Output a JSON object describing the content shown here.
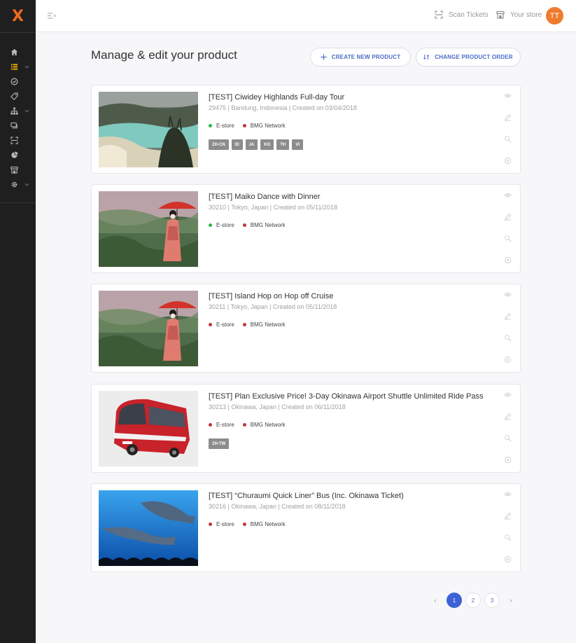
{
  "app": {
    "logo_text": "X",
    "brand_color": "#f26a21",
    "accent_color": "#3d62d6"
  },
  "sidebar": {
    "items": [
      {
        "icon": "home-icon"
      },
      {
        "icon": "list-icon",
        "active": true,
        "has_caret": true
      },
      {
        "icon": "check-circle-icon"
      },
      {
        "icon": "tag-icon"
      },
      {
        "icon": "sitemap-icon",
        "has_caret": true
      },
      {
        "icon": "chat-icon"
      },
      {
        "icon": "scan-icon"
      },
      {
        "icon": "pie-chart-icon"
      },
      {
        "icon": "store-icon"
      },
      {
        "icon": "gear-icon",
        "has_caret": true
      }
    ]
  },
  "topbar": {
    "scan_label": "Scan Tickets",
    "store_label": "Your store",
    "avatar_initials": "TT"
  },
  "page": {
    "title": "Manage & edit your product",
    "create_button": "CREATE NEW PRODUCT",
    "order_button": "CHANGE PRODUCT ORDER"
  },
  "products": [
    {
      "title": "[TEST] Ciwidey Highlands Full-day Tour",
      "meta": "29475 | Bandung, Indonesia | Created on 03/04/2018",
      "channels": [
        {
          "label": "E-store",
          "status_color": "#2db84d"
        },
        {
          "label": "BMG Network",
          "status_color": "#c0363a"
        }
      ],
      "languages": [
        "ZH-CN",
        "ID",
        "JA",
        "KO",
        "TH",
        "VI"
      ],
      "image": "crater-lake-image"
    },
    {
      "title": "[TEST] Maiko Dance with Dinner",
      "meta": "30210 | Tokyo, Japan | Created on 05/11/2018",
      "channels": [
        {
          "label": "E-store",
          "status_color": "#2db84d"
        },
        {
          "label": "BMG Network",
          "status_color": "#c0363a"
        }
      ],
      "languages": [],
      "image": "maiko-umbrella-image"
    },
    {
      "title": "[TEST] Island Hop on Hop off Cruise",
      "meta": "30211 | Tokyo, Japan | Created on 05/11/2018",
      "channels": [
        {
          "label": "E-store",
          "status_color": "#c0363a"
        },
        {
          "label": "BMG Network",
          "status_color": "#c0363a"
        }
      ],
      "languages": [],
      "image": "maiko-umbrella-image"
    },
    {
      "title": "[TEST] Plan Exclusive Price! 3-Day Okinawa Airport Shuttle Unlimited Ride Pass",
      "meta": "30213 | Okinawa, Japan | Created on 06/11/2018",
      "channels": [
        {
          "label": "E-store",
          "status_color": "#c0363a"
        },
        {
          "label": "BMG Network",
          "status_color": "#c0363a"
        }
      ],
      "languages": [
        "ZH-TW"
      ],
      "image": "red-bus-image"
    },
    {
      "title": "[TEST] “Churaumi Quick Liner” Bus (Inc. Okinawa Ticket)",
      "meta": "30216 | Okinawa, Japan | Created on 08/11/2018",
      "channels": [
        {
          "label": "E-store",
          "status_color": "#c0363a"
        },
        {
          "label": "BMG Network",
          "status_color": "#c0363a"
        }
      ],
      "languages": [],
      "image": "aquarium-whale-shark-image"
    }
  ],
  "pagination": {
    "prev": "‹",
    "next": "›",
    "pages": [
      "1",
      "2",
      "3"
    ],
    "current": "1"
  }
}
